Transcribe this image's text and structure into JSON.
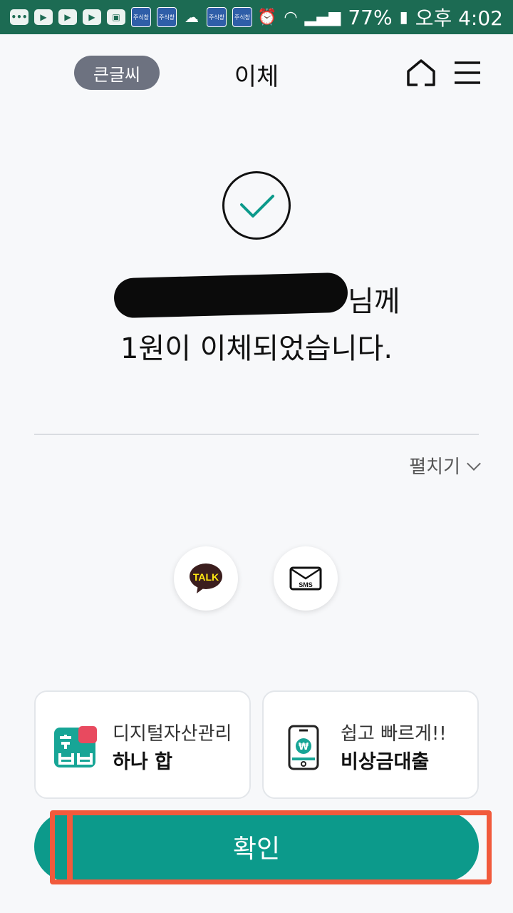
{
  "status_bar": {
    "battery": "77%",
    "time": "오후 4:02",
    "notification_app_label": "주식창"
  },
  "header": {
    "big_font_label": "큰글씨",
    "title": "이체"
  },
  "result": {
    "recipient_suffix": "님께",
    "message": "1원이 이체되었습니다."
  },
  "expand_label": "펼치기",
  "share": {
    "talk_label": "TALK",
    "sms_label": "SMS"
  },
  "cards": [
    {
      "sub": "디지털자산관리",
      "main": "하나 합"
    },
    {
      "sub": "쉽고 빠르게!!",
      "main": "비상금대출"
    }
  ],
  "confirm_label": "확인",
  "colors": {
    "status_bar": "#1c6b53",
    "accent": "#0c9a8b",
    "highlight": "#f15a3c"
  }
}
